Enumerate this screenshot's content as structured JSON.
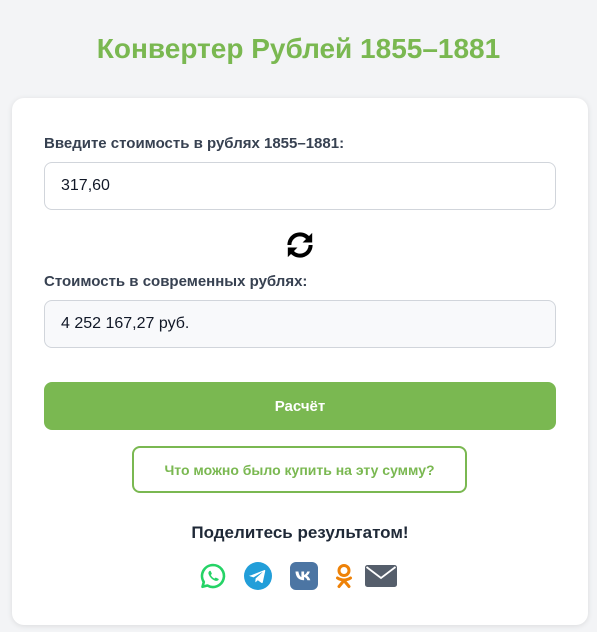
{
  "page": {
    "title": "Конвертер Рублей 1855–1881"
  },
  "converter": {
    "input_label": "Введите стоимость в рублях 1855–1881:",
    "input_value": "317,60",
    "swap_icon": "refresh-arrows-icon",
    "output_label": "Стоимость в современных рублях:",
    "output_value": "4 252 167,27 руб.",
    "calc_button_label": "Расчёт",
    "buy_button_label": "Что можно было купить на эту сумму?"
  },
  "share": {
    "heading": "Поделитесь результатом!",
    "items": [
      {
        "name": "whatsapp",
        "icon": "whatsapp-icon",
        "color": "#25d366"
      },
      {
        "name": "telegram",
        "icon": "telegram-icon",
        "color": "#229ed9"
      },
      {
        "name": "vk",
        "icon": "vk-icon",
        "color": "#4c75a3"
      },
      {
        "name": "odnoklassniki",
        "icon": "odnoklassniki-icon",
        "color": "#ee8208"
      },
      {
        "name": "email",
        "icon": "email-icon",
        "color": "#555e6b"
      }
    ]
  },
  "colors": {
    "accent": "#7ab851",
    "background": "#f3f4f6",
    "card": "#ffffff"
  }
}
